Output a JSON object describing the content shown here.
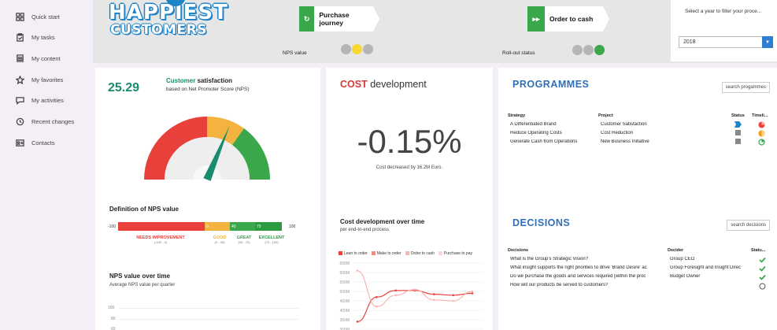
{
  "sidebar": {
    "items": [
      {
        "label": "Quick start",
        "icon": "grid-icon"
      },
      {
        "label": "My tasks",
        "icon": "clipboard-icon"
      },
      {
        "label": "My content",
        "icon": "content-icon"
      },
      {
        "label": "My favorites",
        "icon": "star-icon"
      },
      {
        "label": "My activities",
        "icon": "chat-icon"
      },
      {
        "label": "Recent changes",
        "icon": "history-icon"
      },
      {
        "label": "Contacts",
        "icon": "contacts-icon"
      }
    ]
  },
  "header": {
    "logo_line1": "HAPPIEST",
    "logo_line2": "CUSTOMERS",
    "journey_label": "Purchase journey",
    "order_label": "Order to cash",
    "nps_value_label": "NPS value",
    "rollout_label": "Roll-out status",
    "colors": {
      "green": "#3aa74a",
      "yellow": "#f5d931",
      "grey": "#b5b5b5"
    }
  },
  "filter": {
    "label": "Select a year to filter your proce...",
    "selected_year": "2018"
  },
  "satisfaction": {
    "value": "25.29",
    "title_colored": "Customer",
    "title_rest": " satisfaction",
    "subtitle": "based on Net Promoter Score (NPS)",
    "gauge_value": 25.29,
    "gauge_min": -100,
    "gauge_max": 100
  },
  "nps_definition": {
    "title": "Definition of NPS value",
    "min": "-100",
    "max": "100",
    "segments": [
      {
        "label": "",
        "color": "#e8413b",
        "from": -100,
        "to": 0
      },
      {
        "label": "0",
        "color": "#f4b33e",
        "from": 0,
        "to": 40
      },
      {
        "label": "40",
        "color": "#3aa74a",
        "from": 40,
        "to": 70
      },
      {
        "label": "70",
        "color": "#2b9a40",
        "from": 70,
        "to": 100
      }
    ],
    "categories": [
      {
        "name": "NEEDS IMPROVEMENT",
        "range": "(-100 - 0)",
        "color": "#e8413b"
      },
      {
        "name": "GOOD",
        "range": "(0 - 40)",
        "color": "#f4b33e"
      },
      {
        "name": "GREAT",
        "range": "(40 - 70)",
        "color": "#3aa74a"
      },
      {
        "name": "EXCELLENT",
        "range": "(70 - 100)",
        "color": "#2b9a40"
      }
    ]
  },
  "nps_quarter": {
    "title": "NPS value over time",
    "subtitle": "Average NPS value per quarter",
    "y_ticks": [
      "100",
      "80",
      "60"
    ]
  },
  "cost": {
    "title_colored": "COST",
    "title_rest": " development",
    "big_value": "-0.15%",
    "subtitle": "Cost decreased by 16.2M Euro.",
    "over_time_title": "Cost development over time",
    "over_time_subtitle": "per end-to-end process"
  },
  "programmes": {
    "title": "PROGRAMMES",
    "search_label": "search progammes",
    "columns": [
      "Strategy",
      "Project",
      "Status",
      "Timeli..."
    ],
    "rows": [
      {
        "strategy": "A Differentiated Brand",
        "project": "Customer Satisfaction",
        "status": "arrow",
        "timeline": "red"
      },
      {
        "strategy": "Reduce Operating Costs",
        "project": "Cost Reduction",
        "status": "square",
        "timeline": "orange"
      },
      {
        "strategy": "Generate Cash from Operations",
        "project": "New Business Initiative",
        "status": "square",
        "timeline": "green"
      }
    ]
  },
  "decisions": {
    "title": "DECISIONS",
    "search_label": "search decisions",
    "columns": [
      "Decisions",
      "Decider",
      "Statu..."
    ],
    "rows": [
      {
        "decision": "What is the Group's Strategic Vision?",
        "decider": "Group CEO",
        "status": "check"
      },
      {
        "decision": "What insight supports the right priorities to drive 'Brand Desire' ac",
        "decider": "Group Foresight and Insight Direc",
        "status": "check"
      },
      {
        "decision": "Do we purchase the goods and services required [within the proc",
        "decider": "Budget Owner",
        "status": "check"
      },
      {
        "decision": "How will our products be served to customers?",
        "decider": "",
        "status": "open"
      }
    ]
  },
  "chart_data": {
    "type": "line",
    "title": "Cost development over time",
    "subtitle": "per end-to-end process",
    "x": [
      1,
      2,
      3,
      4,
      5,
      6
    ],
    "ylim": [
      300,
      650
    ],
    "y_ticks": [
      "650M",
      "600M",
      "550M",
      "500M",
      "450M",
      "400M",
      "350M",
      "300M"
    ],
    "series": [
      {
        "name": "Lean to order",
        "color": "#e8413b",
        "values": [
          340,
          470,
          505,
          505,
          485,
          480,
          490
        ]
      },
      {
        "name": "Make to order",
        "color": "#f08a84",
        "values": []
      },
      {
        "name": "Order to cash",
        "color": "#f7b7b3",
        "values": [
          610,
          420,
          480,
          510,
          455,
          450,
          500
        ]
      },
      {
        "name": "Purchase to pay",
        "color": "#fbd6d3",
        "values": []
      }
    ],
    "legend": "top"
  }
}
